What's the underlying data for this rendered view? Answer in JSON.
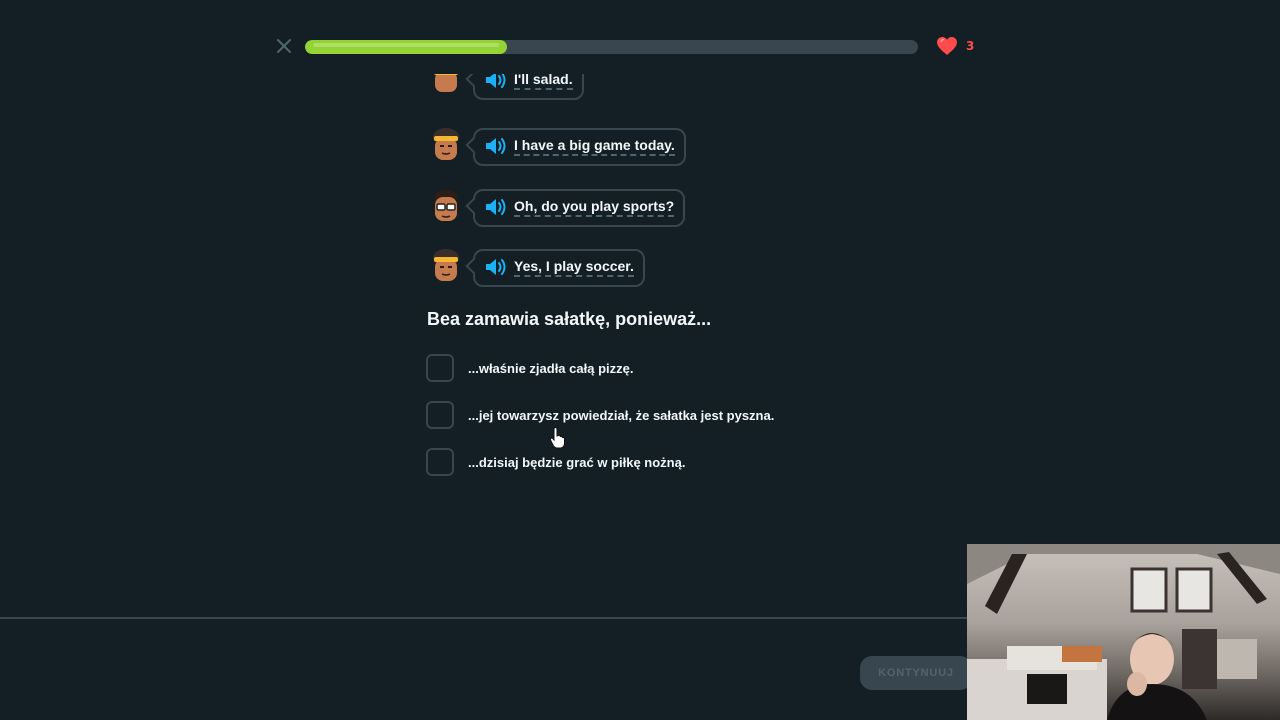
{
  "header": {
    "progress_percent": 33,
    "hearts_count": "3",
    "close_icon": "close-icon",
    "heart_icon": "heart-icon"
  },
  "dialog": [
    {
      "speaker": "girl-headband-avatar",
      "text": "I'll salad."
    },
    {
      "speaker": "girl-headband-avatar",
      "text": "I have a big game today."
    },
    {
      "speaker": "boy-glasses-avatar",
      "text": "Oh, do you play sports?"
    },
    {
      "speaker": "girl-headband-avatar",
      "text": "Yes, I play soccer."
    }
  ],
  "question": "Bea zamawia sałatkę, ponieważ...",
  "options": [
    "...właśnie zjadła całą pizzę.",
    "...jej towarzysz powiedział, że sałatka jest pyszna.",
    "...dzisiaj będzie grać w piłkę nożną."
  ],
  "footer": {
    "continue_label": "KONTYNUUJ"
  },
  "colors": {
    "background": "#131f24",
    "progress_fill": "#93d333",
    "border": "#37464f",
    "heart": "#ff4b4b",
    "speaker": "#1cb0f6"
  }
}
